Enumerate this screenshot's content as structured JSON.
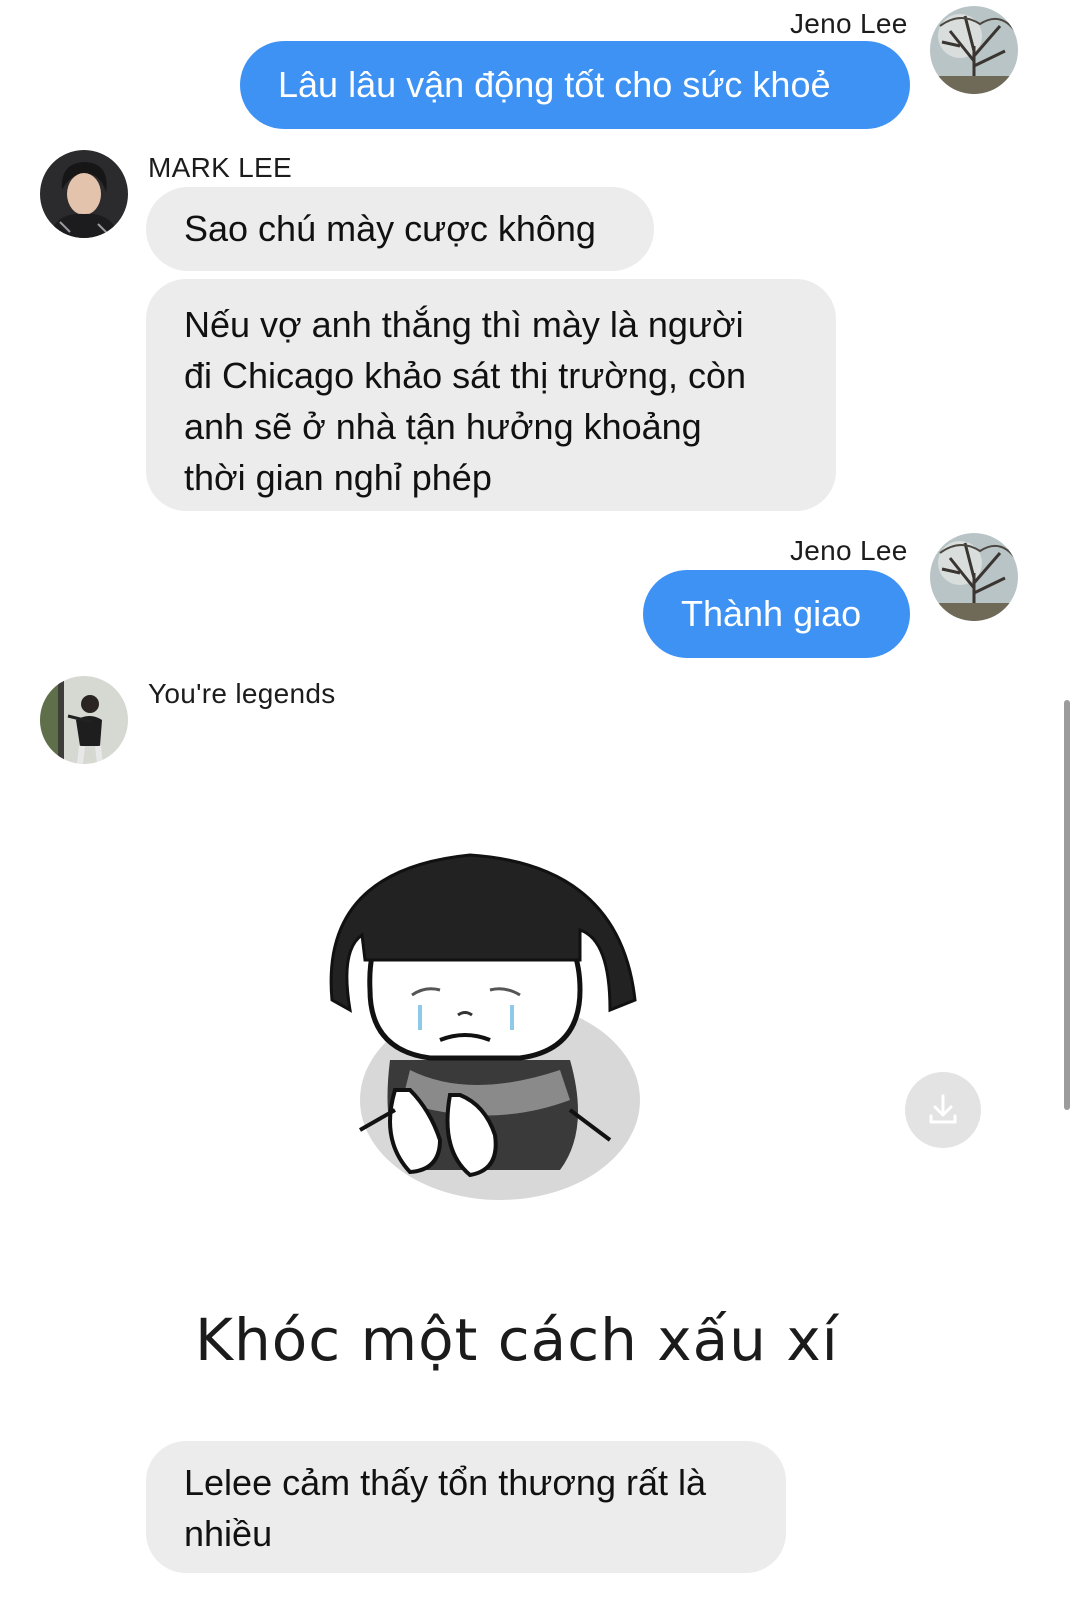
{
  "messages": [
    {
      "sender": "Jeno Lee",
      "text": "Lâu lâu vận động tốt cho sức khoẻ"
    },
    {
      "sender": "MARK LEE",
      "texts": [
        "Sao chú mày cược không",
        [
          "Nếu vợ anh thắng thì mày là người",
          "đi Chicago khảo sát thị trường, còn",
          "anh sẽ ở nhà tận hưởng khoảng",
          "thời gian nghỉ  phép"
        ]
      ]
    },
    {
      "sender": "Jeno Lee",
      "text": "Thành giao"
    },
    {
      "sender": "You're legends",
      "sticker_caption": "Khóc một cách xấu xí",
      "text": [
        "Lelee cảm thấy tổn thương rất là",
        "nhiều"
      ]
    }
  ],
  "colors": {
    "outgoing_bubble": "#3e92f4",
    "incoming_bubble": "#ececec"
  },
  "icons": {
    "download": "download-icon"
  }
}
